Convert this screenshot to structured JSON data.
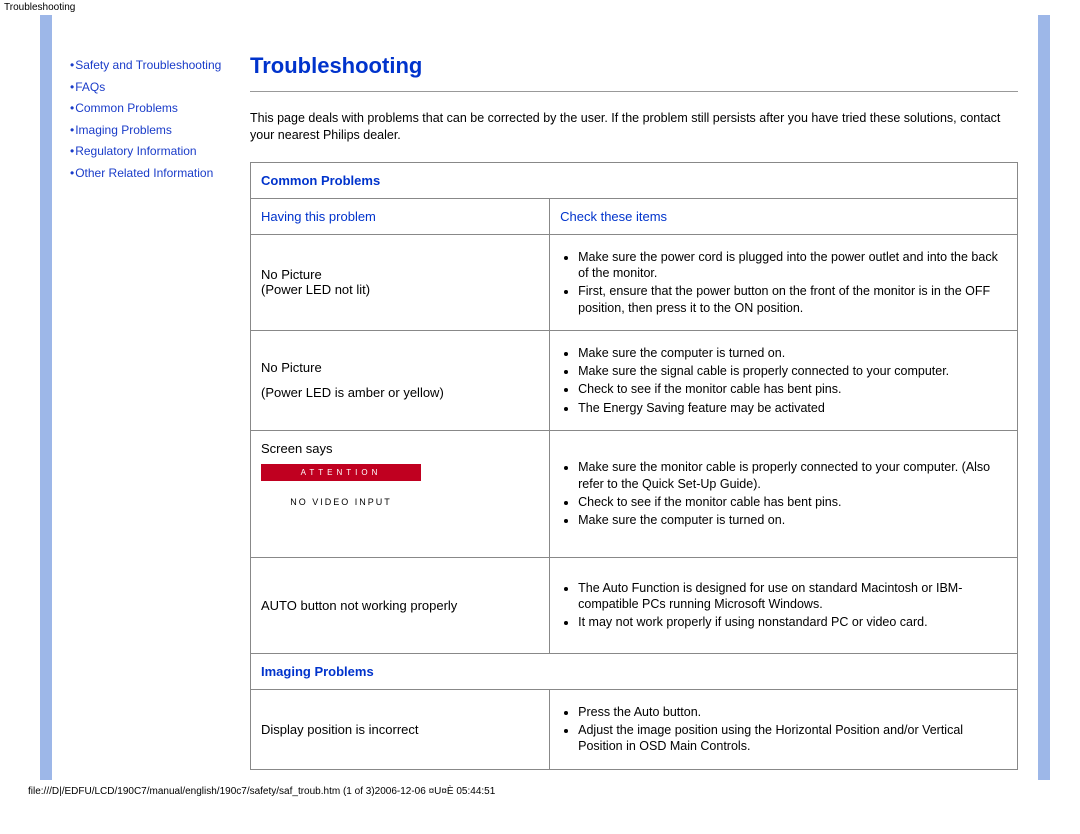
{
  "top_label": "Troubleshooting",
  "sidebar": {
    "items": [
      "Safety and Troubleshooting",
      "FAQs",
      "Common Problems",
      "Imaging Problems",
      "Regulatory Information",
      "Other Related Information"
    ]
  },
  "page": {
    "title": "Troubleshooting",
    "intro": "This page deals with problems that can be corrected by the user. If the problem still persists after you have tried these solutions, contact your nearest Philips dealer."
  },
  "sections": {
    "common": "Common Problems",
    "imaging": "Imaging Problems",
    "col1": "Having this problem",
    "col2": "Check these items"
  },
  "osd": {
    "header": "ATTENTION",
    "body": "NO VIDEO INPUT"
  },
  "rows": [
    {
      "problem_lines": [
        "No Picture",
        "(Power LED not lit)"
      ],
      "checks": [
        "Make sure the power cord is plugged into the power outlet and into the back of the monitor.",
        "First, ensure that the power button on the front of the monitor is in the OFF position, then press it to the ON position."
      ]
    },
    {
      "problem_lines": [
        "No Picture",
        "",
        "(Power LED is amber or yellow)"
      ],
      "checks": [
        "Make sure the computer is turned on.",
        "Make sure the signal cable is properly connected to your computer.",
        "Check to see if the monitor cable has bent pins.",
        "The Energy Saving feature may be activated"
      ]
    },
    {
      "problem_lines": [
        "Screen says"
      ],
      "has_osd": true,
      "checks": [
        "Make sure the monitor cable is properly connected to your computer. (Also refer to the Quick Set-Up Guide).",
        "Check to see if the monitor cable has bent pins.",
        "Make sure the computer is turned on."
      ]
    },
    {
      "problem_lines": [
        "AUTO button not working properly"
      ],
      "checks": [
        "The Auto Function is designed for use on standard Macintosh or IBM-compatible PCs running Microsoft Windows.",
        "It may not work properly if using nonstandard PC or video card."
      ]
    }
  ],
  "imaging_rows": [
    {
      "problem_lines": [
        "Display position is incorrect"
      ],
      "checks": [
        "Press the Auto button.",
        "Adjust the image position using the Horizontal Position and/or Vertical Position in OSD Main Controls."
      ]
    }
  ],
  "footer": "file:///D|/EDFU/LCD/190C7/manual/english/190c7/safety/saf_troub.htm (1 of 3)2006-12-06 ¤U¤È 05:44:51"
}
